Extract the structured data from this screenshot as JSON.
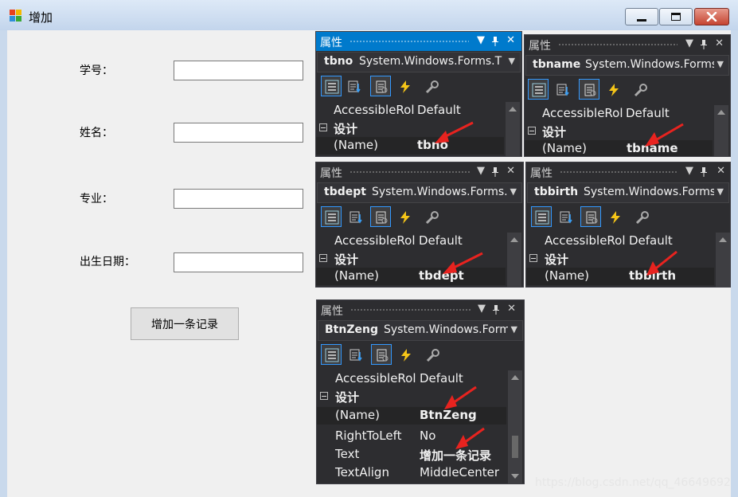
{
  "window": {
    "title": "增加"
  },
  "form": {
    "labels": {
      "xuehao": "学号：",
      "xingming": "姓名：",
      "zhuanye": "专业：",
      "chusheng": "出生日期："
    },
    "inputs": {
      "tbno": "",
      "tbname": "",
      "tbdept": "",
      "tbbirth": ""
    },
    "button_label": "增加一条记录"
  },
  "panels": [
    {
      "title": "属性",
      "object": "tbno",
      "type": "System.Windows.Forms.T",
      "active": true,
      "rows": [
        {
          "k": "AccessibleRol",
          "v": "Default"
        }
      ],
      "category": "设计",
      "name_row": {
        "k": "(Name)",
        "v": "tbno"
      }
    },
    {
      "title": "属性",
      "object": "tbname",
      "type": "System.Windows.Forms.Form",
      "active": false,
      "rows": [
        {
          "k": "AccessibleRol",
          "v": "Default"
        }
      ],
      "category": "设计",
      "name_row": {
        "k": "(Name)",
        "v": "tbname"
      }
    },
    {
      "title": "属性",
      "object": "tbdept",
      "type": "System.Windows.Forms.Form",
      "active": false,
      "rows": [
        {
          "k": "AccessibleRol",
          "v": "Default"
        }
      ],
      "category": "设计",
      "name_row": {
        "k": "(Name)",
        "v": "tbdept"
      }
    },
    {
      "title": "属性",
      "object": "tbbirth",
      "type": "System.Windows.Forms.Form",
      "active": false,
      "rows": [
        {
          "k": "AccessibleRol",
          "v": "Default"
        }
      ],
      "category": "设计",
      "name_row": {
        "k": "(Name)",
        "v": "tbbirth"
      }
    },
    {
      "title": "属性",
      "object": "BtnZeng",
      "type": "System.Windows.Forms.Form",
      "active": false,
      "rows": [
        {
          "k": "AccessibleRol",
          "v": "Default"
        }
      ],
      "category": "设计",
      "name_row": {
        "k": "(Name)",
        "v": "BtnZeng"
      },
      "extra_rows": [
        {
          "k": "RightToLeft",
          "v": "No"
        },
        {
          "k": "Text",
          "v": "增加一条记录"
        },
        {
          "k": "TextAlign",
          "v": "MiddleCenter"
        }
      ]
    }
  ],
  "panel_buttons": {
    "dropdown": "▼",
    "pin": "ᵖ",
    "close": "✕"
  },
  "icons": {
    "categorized": "categorized-icon",
    "alphabetical": "alphabetical-icon",
    "properties": "properties-icon",
    "events": "events-icon",
    "property_pages": "property-pages-icon"
  },
  "colors": {
    "accent": "#007acc",
    "dark_bg": "#2d2d30",
    "arrow": "#e8231f"
  },
  "watermark": "https://blog.csdn.net/qq_46649692"
}
